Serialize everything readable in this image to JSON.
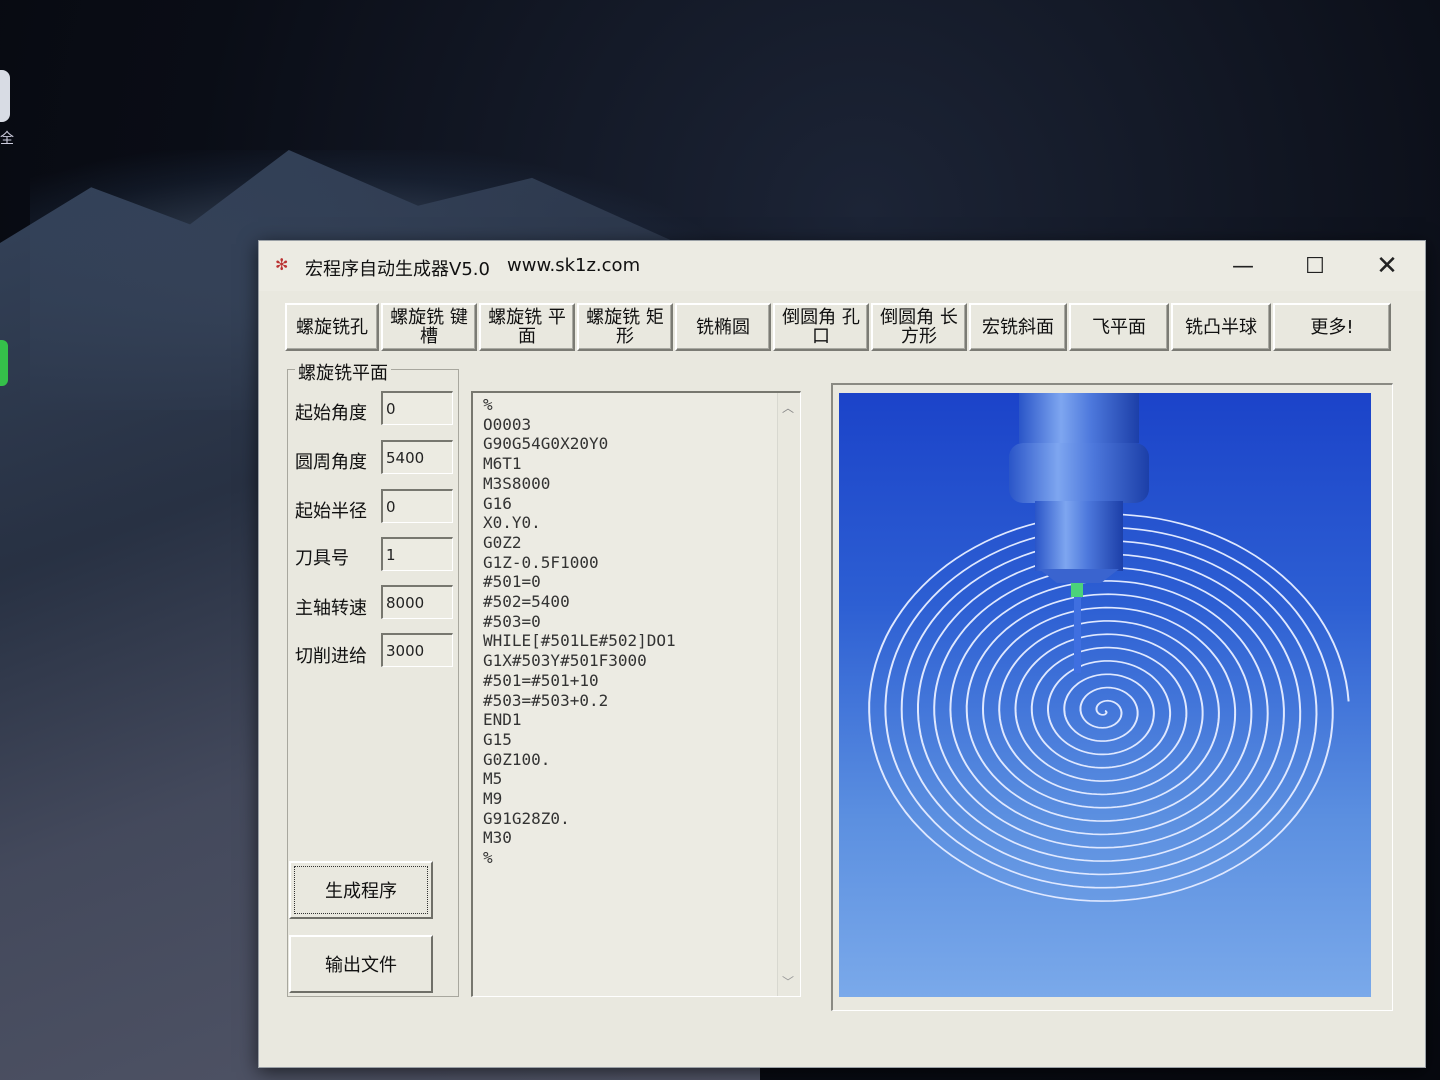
{
  "window": {
    "icon": "macro-icon",
    "title": "宏程序自动生成器V5.0",
    "url": "www.sk1z.com",
    "controls": {
      "minimize": "—",
      "maximize": "☐",
      "close": "✕"
    }
  },
  "desktop": {
    "label": "全"
  },
  "tabs": [
    {
      "label": "螺旋铣孔"
    },
    {
      "label": "螺旋铣 键\n槽"
    },
    {
      "label": "螺旋铣 平\n面"
    },
    {
      "label": "螺旋铣 矩\n形"
    },
    {
      "label": "铣椭圆"
    },
    {
      "label": "倒圆角 孔\n口"
    },
    {
      "label": "倒圆角 长\n方形"
    },
    {
      "label": "宏铣斜面"
    },
    {
      "label": "飞平面"
    },
    {
      "label": "铣凸半球"
    },
    {
      "label": "更多!"
    }
  ],
  "group": {
    "title": "螺旋铣平面",
    "params": [
      {
        "label": "起始角度",
        "value": "0"
      },
      {
        "label": "圆周角度",
        "value": "5400"
      },
      {
        "label": "起始半径",
        "value": "0"
      },
      {
        "label": "刀具号",
        "value": "1"
      },
      {
        "label": "主轴转速",
        "value": "8000"
      },
      {
        "label": "切削进给",
        "value": "3000"
      }
    ],
    "generate_label": "生成程序",
    "export_label": "输出文件"
  },
  "code": [
    "%",
    "O0003",
    "G90G54G0X20Y0",
    "M6T1",
    "M3S8000",
    "G16",
    "X0.Y0.",
    "G0Z2",
    "G1Z-0.5F1000",
    "#501=0",
    "#502=5400",
    "#503=0",
    "WHILE[#501LE#502]DO1",
    "G1X#503Y#501F3000",
    "#501=#501+10",
    "#503=#503+0.2",
    "END1",
    "G15",
    "G0Z100.",
    "M5",
    "M9",
    "G91G28Z0.",
    "M30",
    "%"
  ],
  "colors": {
    "window_bg": "#e9e8df",
    "preview_top": "#1b43c9",
    "preview_bottom": "#7aa9ea",
    "spiral": "#dfe8ff"
  }
}
